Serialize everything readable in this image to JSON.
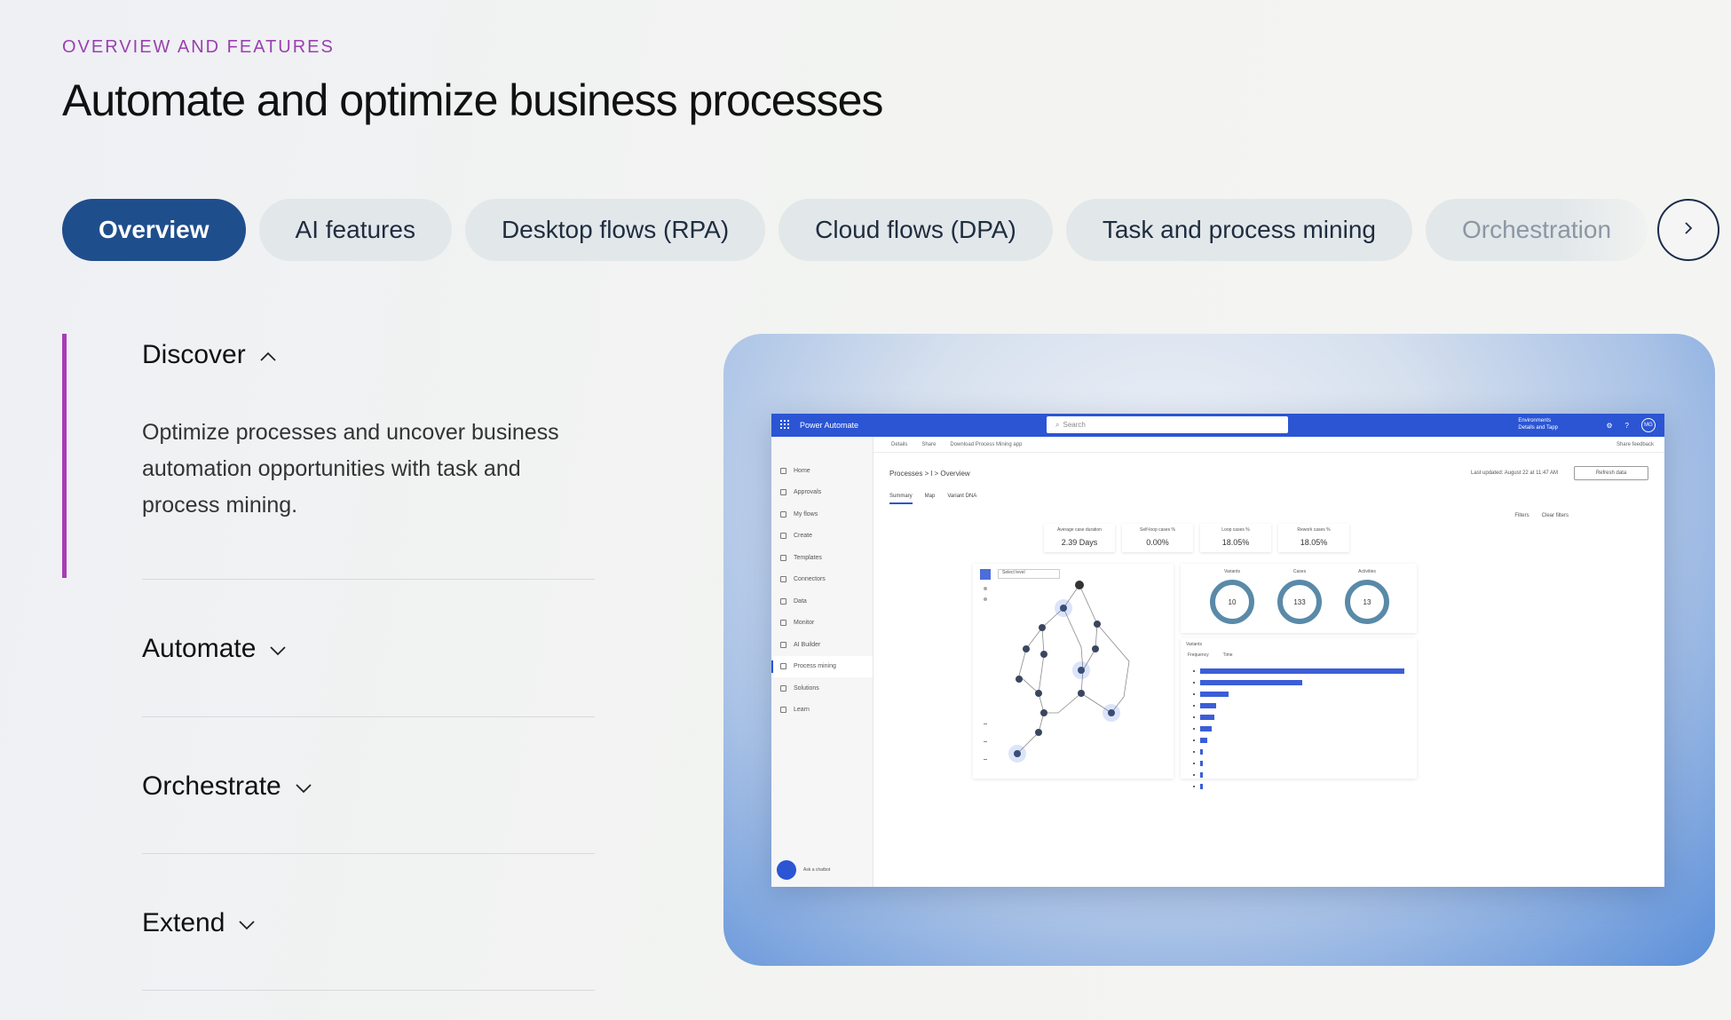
{
  "header": {
    "eyebrow": "OVERVIEW AND FEATURES",
    "title": "Automate and optimize business processes"
  },
  "tabs": [
    {
      "label": "Overview",
      "active": true
    },
    {
      "label": "AI features",
      "active": false
    },
    {
      "label": "Desktop flows (RPA)",
      "active": false
    },
    {
      "label": "Cloud flows (DPA)",
      "active": false
    },
    {
      "label": "Task and process mining",
      "active": false
    },
    {
      "label": "Orchestration",
      "active": false
    }
  ],
  "tab_next_icon": "chevron-right-icon",
  "accordion": {
    "discover": {
      "label": "Discover",
      "expanded": true,
      "body": "Optimize processes and uncover business automation opportunities with task and process mining."
    },
    "automate": {
      "label": "Automate",
      "expanded": false
    },
    "orchestrate": {
      "label": "Orchestrate",
      "expanded": false
    },
    "extend": {
      "label": "Extend",
      "expanded": false
    }
  },
  "colors": {
    "accent_purple": "#a73cb5",
    "tab_active": "#1f4e8c",
    "app_blue": "#2b55d3"
  },
  "screenshot": {
    "app_name": "Power Automate",
    "search_placeholder": "Search",
    "environment": "Environments",
    "environment_name": "Details and Tapp",
    "avatar_initials": "MG",
    "sidebar": [
      {
        "label": "Home"
      },
      {
        "label": "Approvals"
      },
      {
        "label": "My flows"
      },
      {
        "label": "Create"
      },
      {
        "label": "Templates"
      },
      {
        "label": "Connectors"
      },
      {
        "label": "Data"
      },
      {
        "label": "Monitor"
      },
      {
        "label": "AI Builder"
      },
      {
        "label": "Process mining",
        "active": true
      },
      {
        "label": "Solutions"
      },
      {
        "label": "Learn"
      }
    ],
    "ask_chatbot": "Ask a chatbot",
    "cmdbar": [
      "Details",
      "Share",
      "Download Process Mining app"
    ],
    "feedback": "Share feedback",
    "breadcrumb": "Processes  >  l  >  Overview",
    "last_updated": "Last updated: August 22 at 11:47 AM",
    "refresh_label": "Refresh data",
    "subtabs": [
      "Summary",
      "Map",
      "Variant DNA"
    ],
    "filters": [
      "Filters",
      "Clear filters"
    ],
    "kpis": [
      {
        "label": "Average case duration",
        "value": "2.39 Days"
      },
      {
        "label": "Self-loop cases %",
        "value": "0.00%"
      },
      {
        "label": "Loop cases %",
        "value": "18.05%"
      },
      {
        "label": "Rework cases %",
        "value": "18.05%"
      }
    ],
    "map_dropdown": "Select level",
    "rings": [
      {
        "label": "Variants",
        "value": "10"
      },
      {
        "label": "Cases",
        "value": "133"
      },
      {
        "label": "Activities",
        "value": "13"
      }
    ],
    "variants_title": "Variants",
    "variants_tabs": [
      "Frequency",
      "Time"
    ],
    "variant_frequencies": [
      1.0,
      0.5,
      0.14,
      0.08,
      0.07,
      0.055,
      0.035,
      0.015,
      0.01,
      0.01,
      0.01
    ]
  }
}
